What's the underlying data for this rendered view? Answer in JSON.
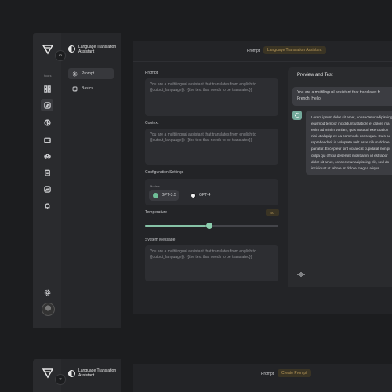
{
  "colors": {
    "accent": "#8ccfae",
    "gold": "#b8995a",
    "gpt35": "#6fbf98",
    "gpt4": "#f2f2f2",
    "bot": "#74aa9c"
  },
  "sidebar": {
    "tools_label": "tools",
    "collapse_glyph": "‹›",
    "icons": [
      "grid-icon",
      "compass-icon",
      "brain-icon",
      "wallet-icon",
      "users-icon",
      "clipboard-icon",
      "chart-icon",
      "bell-icon"
    ],
    "settings_icon": "gear-icon"
  },
  "app": {
    "title": "Language Translation Assistant"
  },
  "nav": [
    {
      "label": "Prompt",
      "icon": "settings-dots-icon",
      "active": true
    },
    {
      "label": "Basics",
      "icon": "puzzle-icon",
      "active": false
    }
  ],
  "topbar": {
    "label": "Prompt",
    "pill": "Language Translation Assistant"
  },
  "form": {
    "prompt_label": "Prompt",
    "prompt_text": "You are a multilingual assistant that translates from english to {{output_language}}: {{the text that needs to be translated}}",
    "context_label": "Context",
    "context_text": "You are a multilingual assistant that translates from english to {{output_language}}: {{the text that needs to be translated}}",
    "config_label": "Configuration Settings",
    "models_label": "Models",
    "models": [
      {
        "name": "GPT-3.5",
        "selected": true
      },
      {
        "name": "GPT-4",
        "selected": false
      }
    ],
    "temperature_label": "Temperature",
    "temperature_value": "50",
    "temperature_fraction": 0.46,
    "system_label": "System Message",
    "system_text": "You are a multilingual assistant that translates from english to {{output_language}}: {{the text that needs to be translated}}"
  },
  "preview": {
    "title": "Preview and Test",
    "user_message_lines": [
      "You are a multilingual assistant that translates fr",
      "French: Hello!"
    ],
    "bot_message_lines": [
      "Lorem ipsum dolor sit amet, consectetur adipiscing",
      "eiusmod tempor incididunt ut labore et dolore ma",
      "enim ad minim veniam, quis nostrud exercitation",
      "nisi ut aliquip ex ea commodo consequat. Duis au",
      "reprehenderit in voluptate velit esse cillum dolore",
      "pariatur. Excepteur sint occaecat cupidatat non pr",
      "culpa qui officia deserunt mollit anim id est labor",
      "dolor sit amet, consectetur adipiscing elit, sed do",
      "incididunt ut labore et dolore magna aliqua."
    ]
  },
  "second_card": {
    "app_title": "Language Translation Assistant",
    "topbar_label": "Prompt",
    "topbar_pill": "Create Prompt"
  }
}
